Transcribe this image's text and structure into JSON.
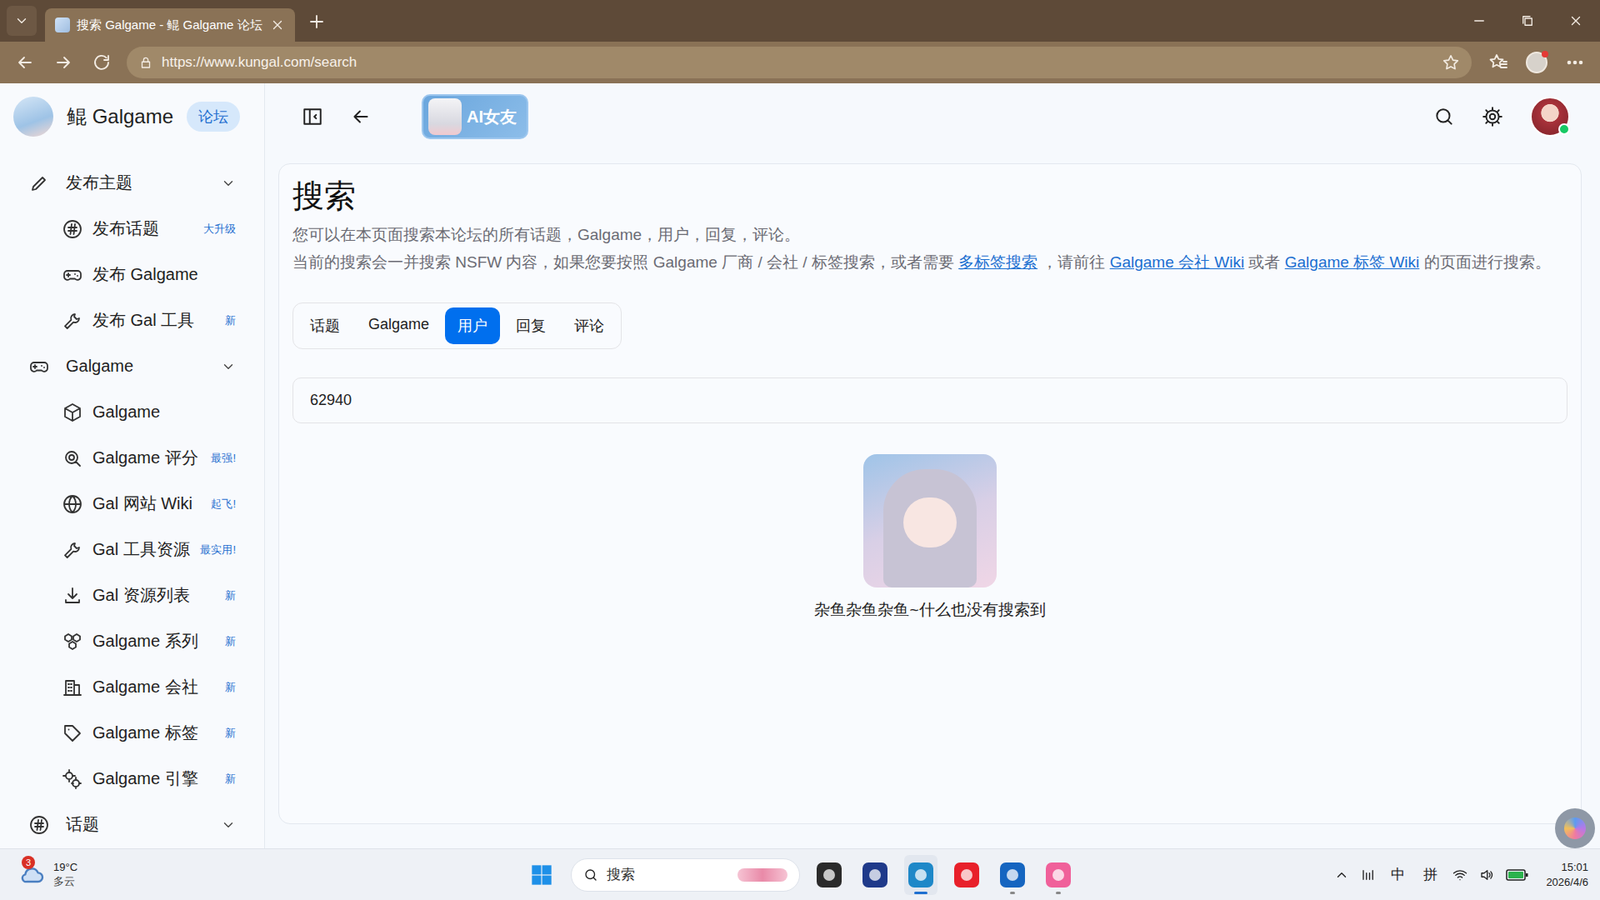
{
  "browser": {
    "tab_title": "搜索 Galgame - 鲲 Galgame 论坛",
    "url": "https://www.kungal.com/search"
  },
  "sidebar": {
    "brand": "鲲 Galgame",
    "brand_badge": "论坛",
    "groups": [
      {
        "label": "发布主题",
        "expanded": true,
        "items": [
          {
            "label": "发布话题",
            "badge": "大升级"
          },
          {
            "label": "发布 Galgame"
          },
          {
            "label": "发布 Gal 工具",
            "badge": "新"
          }
        ]
      },
      {
        "label": "Galgame",
        "expanded": true,
        "items": [
          {
            "label": "Galgame"
          },
          {
            "label": "Galgame 评分",
            "badge": "最强!"
          },
          {
            "label": "Gal 网站 Wiki",
            "badge": "起飞!"
          },
          {
            "label": "Gal 工具资源",
            "badge": "最实用!"
          },
          {
            "label": "Gal 资源列表",
            "badge": "新"
          },
          {
            "label": "Galgame 系列",
            "badge": "新"
          },
          {
            "label": "Galgame 会社",
            "badge": "新"
          },
          {
            "label": "Galgame 标签",
            "badge": "新"
          },
          {
            "label": "Galgame 引擎",
            "badge": "新"
          }
        ]
      },
      {
        "label": "话题",
        "expanded": true,
        "items": []
      }
    ]
  },
  "header": {
    "ai_button": "AI女友"
  },
  "search": {
    "title": "搜索",
    "description": "您可以在本页面搜索本论坛的所有话题，Galgame，用户，回复，评论。",
    "notice": [
      {
        "text": "当前的搜索会一并搜索 NSFW 内容，如果您要按照 Galgame 厂商 / 会社 / 标签搜索，或者需要 ",
        "link": false
      },
      {
        "text": "多标签搜索",
        "link": true
      },
      {
        "text": " ，请前往 ",
        "link": false
      },
      {
        "text": "Galgame 会社 Wiki",
        "link": true
      },
      {
        "text": " 或者 ",
        "link": false
      },
      {
        "text": "Galgame 标签 Wiki",
        "link": true
      },
      {
        "text": " 的页面进行搜索。",
        "link": false
      }
    ],
    "tabs": [
      {
        "label": "话题",
        "selected": false
      },
      {
        "label": "Galgame",
        "selected": false
      },
      {
        "label": "用户",
        "selected": true
      },
      {
        "label": "回复",
        "selected": false
      },
      {
        "label": "评论",
        "selected": false
      }
    ],
    "query": "62940",
    "empty_text": "杂鱼杂鱼杂鱼~什么也没有搜索到"
  },
  "taskbar": {
    "weather": {
      "badge": "3",
      "temperature": "19°C",
      "condition": "多云"
    },
    "search_placeholder": "搜索",
    "apps": [
      {
        "color": "#2b2b2b",
        "active": false,
        "running": false
      },
      {
        "color": "#1f3a8a",
        "active": false,
        "running": false
      },
      {
        "color": "#1e88c8",
        "active": true,
        "running": true
      },
      {
        "color": "#e8202a",
        "active": false,
        "running": false
      },
      {
        "color": "#1565c0",
        "active": false,
        "running": true
      },
      {
        "color": "#f0609a",
        "active": false,
        "running": true
      }
    ],
    "ime": [
      "中",
      "拼"
    ],
    "time": "15:01",
    "date": "2026/4/6"
  }
}
